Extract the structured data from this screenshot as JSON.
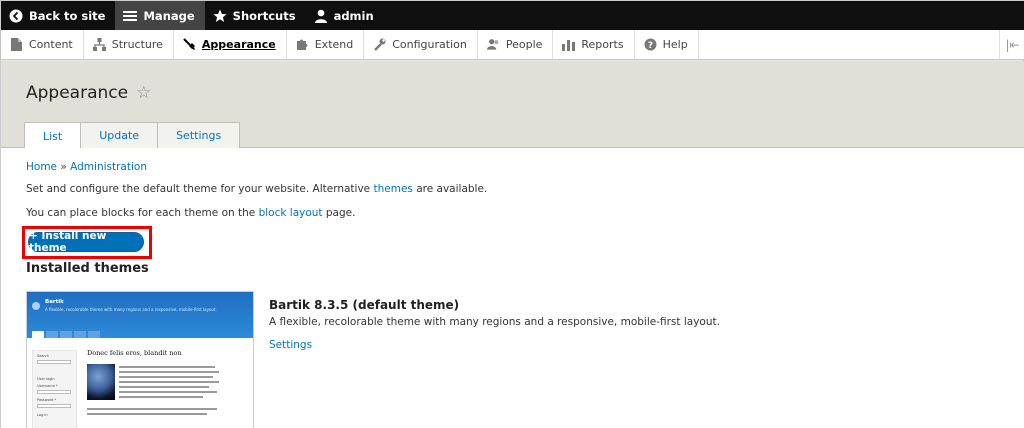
{
  "toolbar": {
    "back_to_site": "Back to site",
    "manage": "Manage",
    "shortcuts": "Shortcuts",
    "user": "admin"
  },
  "tray": {
    "items": [
      {
        "label": "Content",
        "icon": "content-icon"
      },
      {
        "label": "Structure",
        "icon": "structure-icon"
      },
      {
        "label": "Appearance",
        "icon": "paintbrush-icon",
        "active": true
      },
      {
        "label": "Extend",
        "icon": "puzzle-icon"
      },
      {
        "label": "Configuration",
        "icon": "wrench-icon"
      },
      {
        "label": "People",
        "icon": "people-icon"
      },
      {
        "label": "Reports",
        "icon": "bar-chart-icon"
      },
      {
        "label": "Help",
        "icon": "help-icon"
      }
    ]
  },
  "header": {
    "title": "Appearance",
    "tabs": [
      {
        "label": "List",
        "active": true
      },
      {
        "label": "Update"
      },
      {
        "label": "Settings"
      }
    ]
  },
  "breadcrumb": {
    "home": "Home",
    "separator": "»",
    "admin": "Administration"
  },
  "intro": {
    "line1_before": "Set and configure the default theme for your website. Alternative ",
    "line1_link": "themes",
    "line1_after": " are available.",
    "line2_before": "You can place blocks for each theme on the ",
    "line2_link": "block layout",
    "line2_after": " page."
  },
  "install_button": "+ Install new theme",
  "installed_heading": "Installed themes",
  "theme": {
    "name": "Bartik 8.3.5 (default theme)",
    "description": "A flexible, recolorable theme with many regions and a responsive, mobile-first layout.",
    "settings_link": "Settings",
    "preview": {
      "site_name": "Bartik",
      "slogan": "A flexible, recolorable theme with many regions and a responsive, mobile-first layout.",
      "heading": "Donec felis eros, blandit non",
      "search_label": "Search",
      "login_label": "User login",
      "username_label": "Username *",
      "password_label": "Password *",
      "login_button": "Log in"
    }
  },
  "colors": {
    "toolbar": "#0f0f0f",
    "accent": "#0074bd",
    "highlight": "#e00000",
    "header_bg": "#e0e0d8"
  }
}
